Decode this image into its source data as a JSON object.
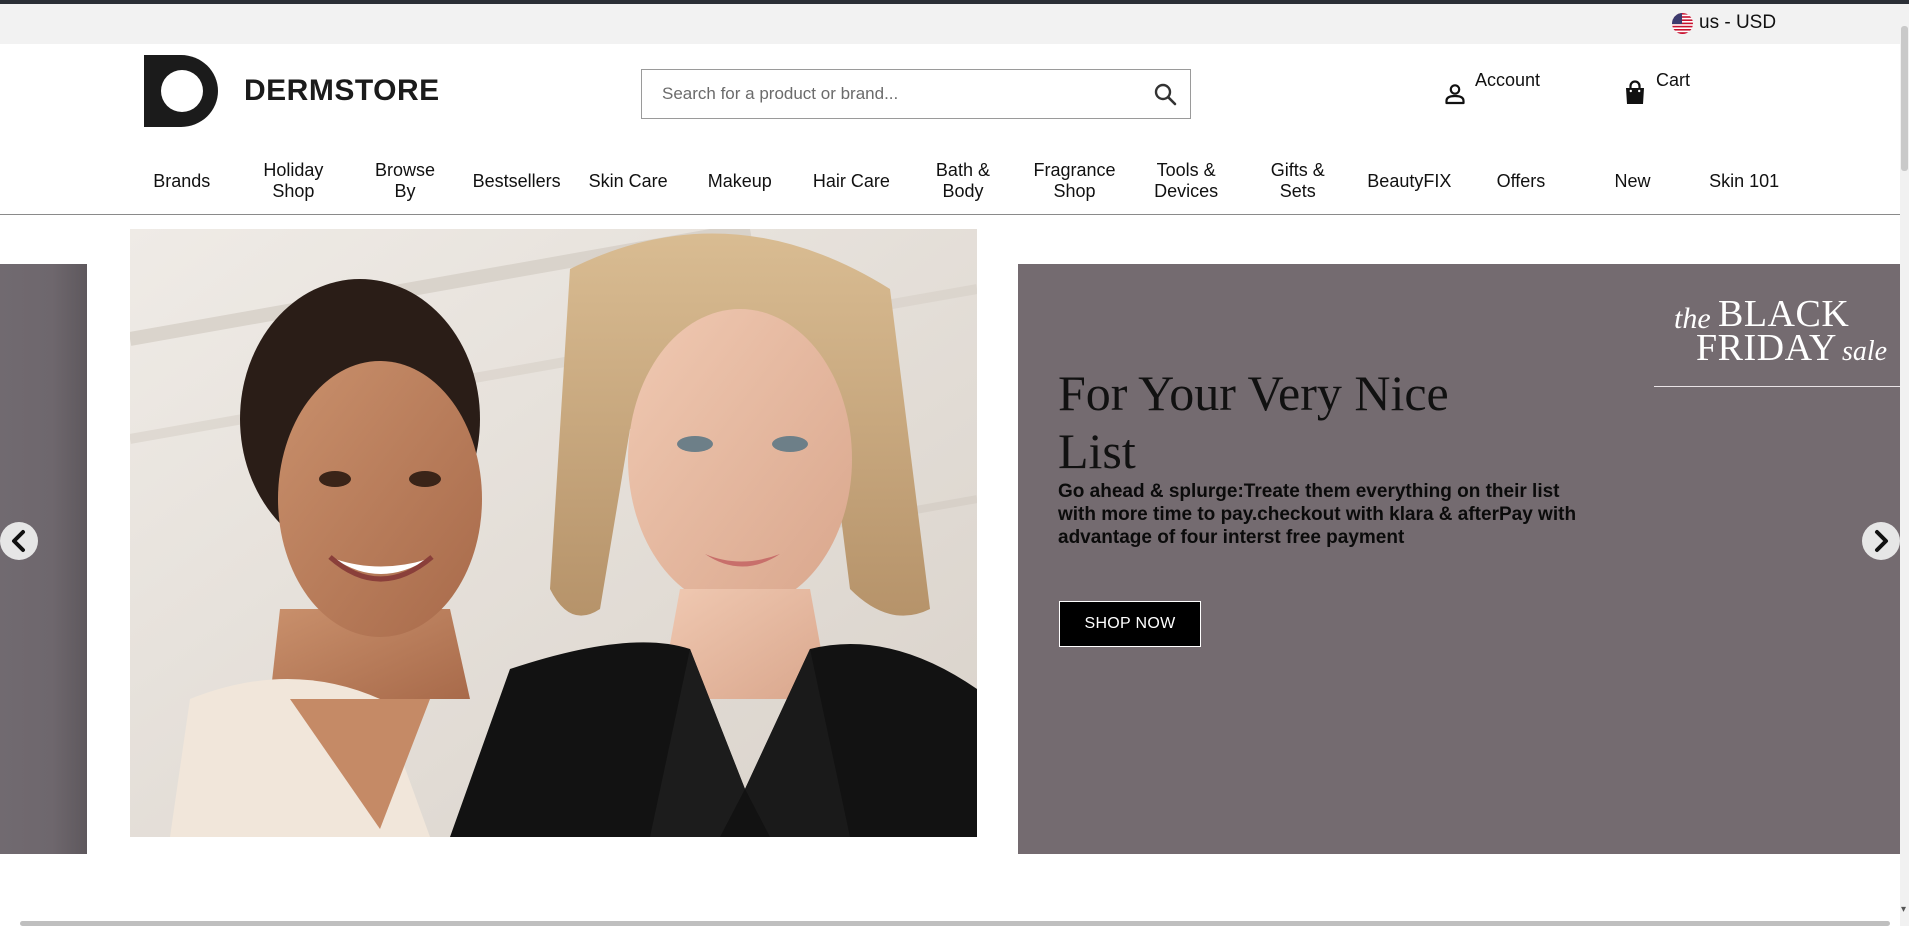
{
  "utility_bar": {
    "locale_label": "us - USD",
    "flag_icon": "us-flag-icon"
  },
  "header": {
    "logo_text": "DERMSTORE",
    "search_placeholder": "Search for a product or brand...",
    "search_icon": "search-icon",
    "account_label": "Account",
    "account_icon": "user-icon",
    "cart_label": "Cart",
    "cart_icon": "shopping-bag-icon"
  },
  "nav": {
    "items": [
      {
        "line1": "Brands",
        "line2": ""
      },
      {
        "line1": "Holiday",
        "line2": "Shop"
      },
      {
        "line1": "Browse",
        "line2": "By"
      },
      {
        "line1": "Bestsellers",
        "line2": ""
      },
      {
        "line1": "Skin Care",
        "line2": ""
      },
      {
        "line1": "Makeup",
        "line2": ""
      },
      {
        "line1": "Hair Care",
        "line2": ""
      },
      {
        "line1": "Bath &",
        "line2": "Body"
      },
      {
        "line1": "Fragrance",
        "line2": "Shop"
      },
      {
        "line1": "Tools &",
        "line2": "Devices"
      },
      {
        "line1": "Gifts &",
        "line2": "Sets"
      },
      {
        "line1": "BeautyFIX",
        "line2": ""
      },
      {
        "line1": "Offers",
        "line2": ""
      },
      {
        "line1": "New",
        "line2": ""
      },
      {
        "line1": "Skin 101",
        "line2": ""
      }
    ]
  },
  "hero": {
    "badge": {
      "the": "the",
      "black": "BLACK",
      "friday": "FRIDAY",
      "sale": "sale"
    },
    "title": "For Your Very Nice List",
    "body": "Go ahead & splurge:Treate them everything on their list with more time to pay.checkout with klara & afterPay with advantage of four interst free payment",
    "cta_label": "SHOP NOW",
    "prev_icon": "chevron-left-icon",
    "next_icon": "chevron-right-icon"
  },
  "colors": {
    "hero_panel": "#746b70",
    "cta_bg": "#000000",
    "text": "#111111"
  }
}
